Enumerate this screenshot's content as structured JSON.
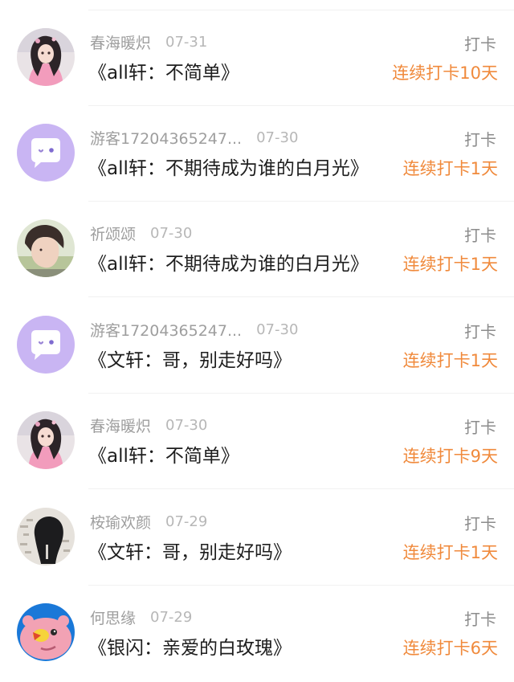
{
  "colors": {
    "streak": "#f08a3c",
    "meta": "#9e9e9e",
    "title": "#1e1e1e",
    "guest_avatar_bg": "#c9b5f3"
  },
  "checkins": [
    {
      "user": "春海暖炽",
      "date": "07-31",
      "book": "《all轩：不简单》",
      "type": "打卡",
      "streak": "连续打卡10天",
      "avatar": "anime-girl-avatar"
    },
    {
      "user": "游客17204365247...",
      "date": "07-30",
      "book": "《all轩：不期待成为谁的白月光》",
      "type": "打卡",
      "streak": "连续打卡1天",
      "avatar": "guest-chat-bubble-avatar"
    },
    {
      "user": "祈颂颂",
      "date": "07-30",
      "book": "《all轩：不期待成为谁的白月光》",
      "type": "打卡",
      "streak": "连续打卡1天",
      "avatar": "portrait-photo-avatar"
    },
    {
      "user": "游客17204365247...",
      "date": "07-30",
      "book": "《文轩：哥，别走好吗》",
      "type": "打卡",
      "streak": "连续打卡1天",
      "avatar": "guest-chat-bubble-avatar"
    },
    {
      "user": "春海暖炽",
      "date": "07-30",
      "book": "《all轩：不简单》",
      "type": "打卡",
      "streak": "连续打卡9天",
      "avatar": "anime-girl-avatar"
    },
    {
      "user": "桉瑜欢颜",
      "date": "07-29",
      "book": "《文轩：哥，别走好吗》",
      "type": "打卡",
      "streak": "连续打卡1天",
      "avatar": "dark-hair-photo-avatar"
    },
    {
      "user": "何思缘",
      "date": "07-29",
      "book": "《银闪：亲爱的白玫瑰》",
      "type": "打卡",
      "streak": "连续打卡6天",
      "avatar": "pink-monster-avatar"
    }
  ]
}
